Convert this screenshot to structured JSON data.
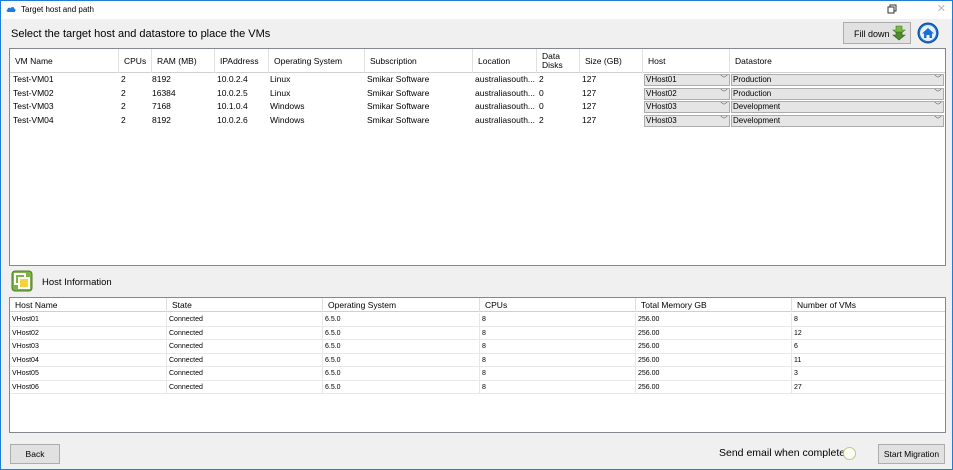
{
  "window": {
    "title": "Target host and path"
  },
  "heading": "Select the target host and datastore to place the VMs",
  "toolbar": {
    "fill_down_label": "Fill down"
  },
  "vm_table": {
    "columns": [
      "VM Name",
      "CPUs",
      "RAM (MB)",
      "IPAddress",
      "Operating System",
      "Subscription",
      "Location",
      "Data Disks",
      "Size (GB)",
      "Host",
      "Datastore"
    ],
    "rows": [
      {
        "name": "Test-VM01",
        "cpus": "2",
        "ram": "8192",
        "ip": "10.0.2.4",
        "os": "Linux",
        "subscription": "Smikar Software",
        "location": "australiasouth...",
        "disks": "2",
        "size": "127",
        "host": "VHost01",
        "datastore": "Production"
      },
      {
        "name": "Test-VM02",
        "cpus": "2",
        "ram": "16384",
        "ip": "10.0.2.5",
        "os": "Linux",
        "subscription": "Smikar Software",
        "location": "australiasouth...",
        "disks": "0",
        "size": "127",
        "host": "VHost02",
        "datastore": "Production"
      },
      {
        "name": "Test-VM03",
        "cpus": "2",
        "ram": "7168",
        "ip": "10.1.0.4",
        "os": "Windows",
        "subscription": "Smikar Software",
        "location": "australiasouth...",
        "disks": "0",
        "size": "127",
        "host": "VHost03",
        "datastore": "Development"
      },
      {
        "name": "Test-VM04",
        "cpus": "2",
        "ram": "8192",
        "ip": "10.0.2.6",
        "os": "Windows",
        "subscription": "Smikar Software",
        "location": "australiasouth...",
        "disks": "2",
        "size": "127",
        "host": "VHost03",
        "datastore": "Development"
      }
    ]
  },
  "host_info": {
    "label": "Host Information",
    "columns": [
      "Host Name",
      "State",
      "Operating System",
      "CPUs",
      "Total Memory GB",
      "Number of VMs"
    ],
    "rows": [
      {
        "name": "VHost01",
        "state": "Connected",
        "os": "6.5.0",
        "cpus": "8",
        "memory": "256.00",
        "vms": "8"
      },
      {
        "name": "VHost02",
        "state": "Connected",
        "os": "6.5.0",
        "cpus": "8",
        "memory": "256.00",
        "vms": "12"
      },
      {
        "name": "VHost03",
        "state": "Connected",
        "os": "6.5.0",
        "cpus": "8",
        "memory": "256.00",
        "vms": "6"
      },
      {
        "name": "VHost04",
        "state": "Connected",
        "os": "6.5.0",
        "cpus": "8",
        "memory": "256.00",
        "vms": "11"
      },
      {
        "name": "VHost05",
        "state": "Connected",
        "os": "6.5.0",
        "cpus": "8",
        "memory": "256.00",
        "vms": "3"
      },
      {
        "name": "VHost06",
        "state": "Connected",
        "os": "6.5.0",
        "cpus": "8",
        "memory": "256.00",
        "vms": "27"
      }
    ]
  },
  "footer": {
    "back_label": "Back",
    "email_label": "Send email when complete:",
    "start_label": "Start Migration"
  },
  "icons": {
    "app": "cloud-icon",
    "restore": "restore-window-icon",
    "close": "close-icon",
    "fill_down": "double-arrow-down-icon",
    "home": "home-icon",
    "host_info": "vmware-icon",
    "dropdown": "chevron-down-icon"
  },
  "colors": {
    "accent": "#1c7ed6",
    "fill_down_arrow": "#4c8c2b",
    "home_blue": "#1e6fd0",
    "host_icon": "#7cb342"
  }
}
